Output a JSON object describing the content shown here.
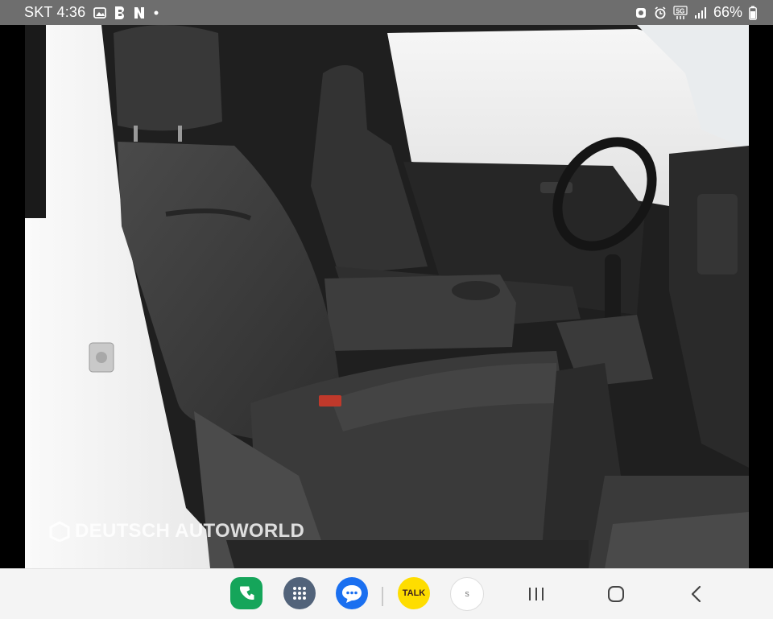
{
  "status_bar": {
    "carrier_time": "SKT 4:36",
    "battery_percent": "66%",
    "network_badge": "5G",
    "left_icons": [
      "gallery-icon",
      "band-app-icon",
      "naver-icon",
      "notification-dot-icon"
    ],
    "right_icons": [
      "app-notify-icon",
      "alarm-icon",
      "5g-icon",
      "signal-icon",
      "battery-icon"
    ]
  },
  "photo": {
    "description_icon": "car-seat-photo",
    "watermark": "DEUTSCH AUTOWORLD"
  },
  "nav_bar": {
    "dock_apps": [
      {
        "name": "phone-app-icon",
        "color": "#15a55a"
      },
      {
        "name": "app-drawer-icon",
        "color": "#52637a"
      },
      {
        "name": "messages-app-icon",
        "color": "#1a6ff0"
      },
      {
        "name": "kakaotalk-app-icon",
        "color": "#fedd00",
        "label": "TALK"
      },
      {
        "name": "recent-app-icon",
        "label": "S"
      }
    ],
    "buttons": [
      "recents-button",
      "home-button",
      "back-button"
    ]
  }
}
